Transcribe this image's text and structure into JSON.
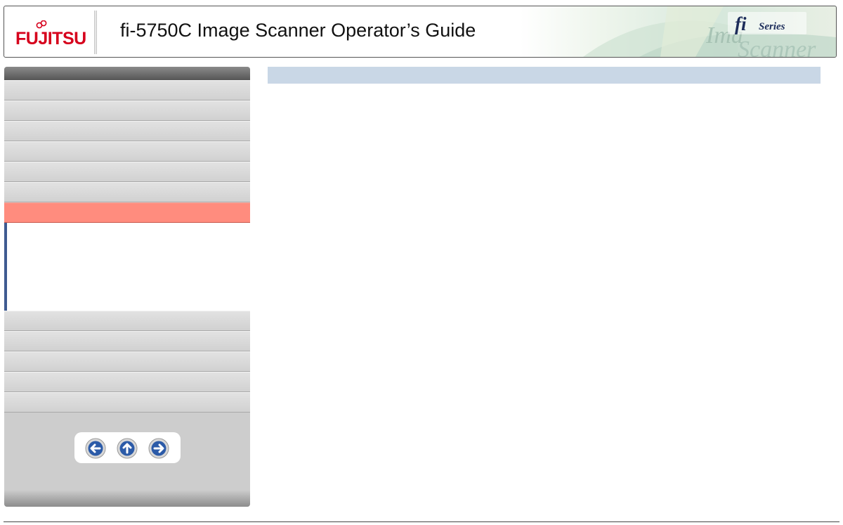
{
  "header": {
    "logo_text": "FUJITSU",
    "title": "fi-5750C Image Scanner Operator’s Guide",
    "brand_series_text": "fi Series",
    "brand_art_text": "Image Scanner"
  },
  "sidebar": {
    "items_top_count": 6,
    "active_index": 6,
    "items_bottom_count": 5,
    "active_color": "#ff8c7e",
    "submenu_accent": "#3f5b91"
  },
  "nav_buttons": [
    {
      "name": "previous-page-button",
      "icon": "arrow-left-icon"
    },
    {
      "name": "up-page-button",
      "icon": "arrow-up-icon"
    },
    {
      "name": "next-page-button",
      "icon": "arrow-right-icon"
    }
  ],
  "colors": {
    "logo_red": "#d6001c",
    "content_bar": "#c9d7e6",
    "nav_button_blue": "#2c5ba8"
  }
}
